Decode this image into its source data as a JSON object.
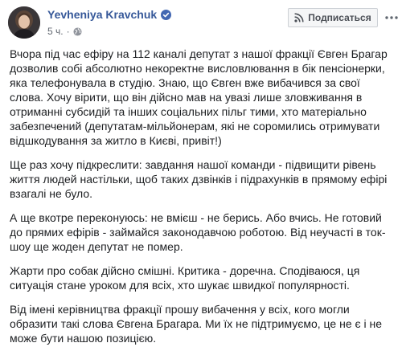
{
  "author": {
    "name": "Yevheniya Kravchuk"
  },
  "meta": {
    "time": "5 ч.",
    "dot": "·"
  },
  "subscribe_label": "Подписаться",
  "paragraphs": [
    "Вчора під час ефіру на 112 каналі депутат з нашої фракції Євген Брагар\nдозволив собі абсолютно некоректне висловлювання в бік пенсіонерки,\nяка телефонувала в студію. Знаю, що Євген вже вибачився за свої\nслова. Хочу вірити, що він дійсно мав на увазі лише зловживання в\nотриманні субсидій та інших соціальних пільг тими, хто матеріально\nзабезпечений (депутатам-мільйонерам, які не соромились отримувати\nвідшкодування за житло в Києві, привіт!)",
    "Ще раз хочу підкреслити: завдання нашої команди - підвищити рівень\nжиття людей настільки, щоб таких дзвінків і підрахунків в прямому ефірі\nвзагалі не було.",
    "А ще вкотре переконуюсь: не вмієш - не берись. Або вчись. Не готовий\nдо прямих ефірів - займайся законодавчою роботою. Від неучасті в ток-\nшоу ще жоден депутат не помер.",
    "Жарти про собак дійсно смішні. Критика - доречна. Сподіваюся, ця\nситуація стане уроком для всіх, хто шукає швидкої популярності.",
    "Від імені керівництва фракції прошу вибачення у всіх, кого могли\nобразити такі слова Євгена Брагара. Ми їх не підтримуємо, це не є і не\nможе бути нашою позицією."
  ],
  "colors": {
    "author_name": "#365899",
    "body_text": "#1c1e21",
    "meta_text": "#616770",
    "button_bg": "#f5f6f7",
    "button_border": "#ccd0d5",
    "verified_badge": "#4267b2"
  },
  "icons": {
    "verified": "verified-badge-icon",
    "globe": "globe-icon",
    "subscribe": "rss-icon",
    "more": "more-dots-icon"
  }
}
